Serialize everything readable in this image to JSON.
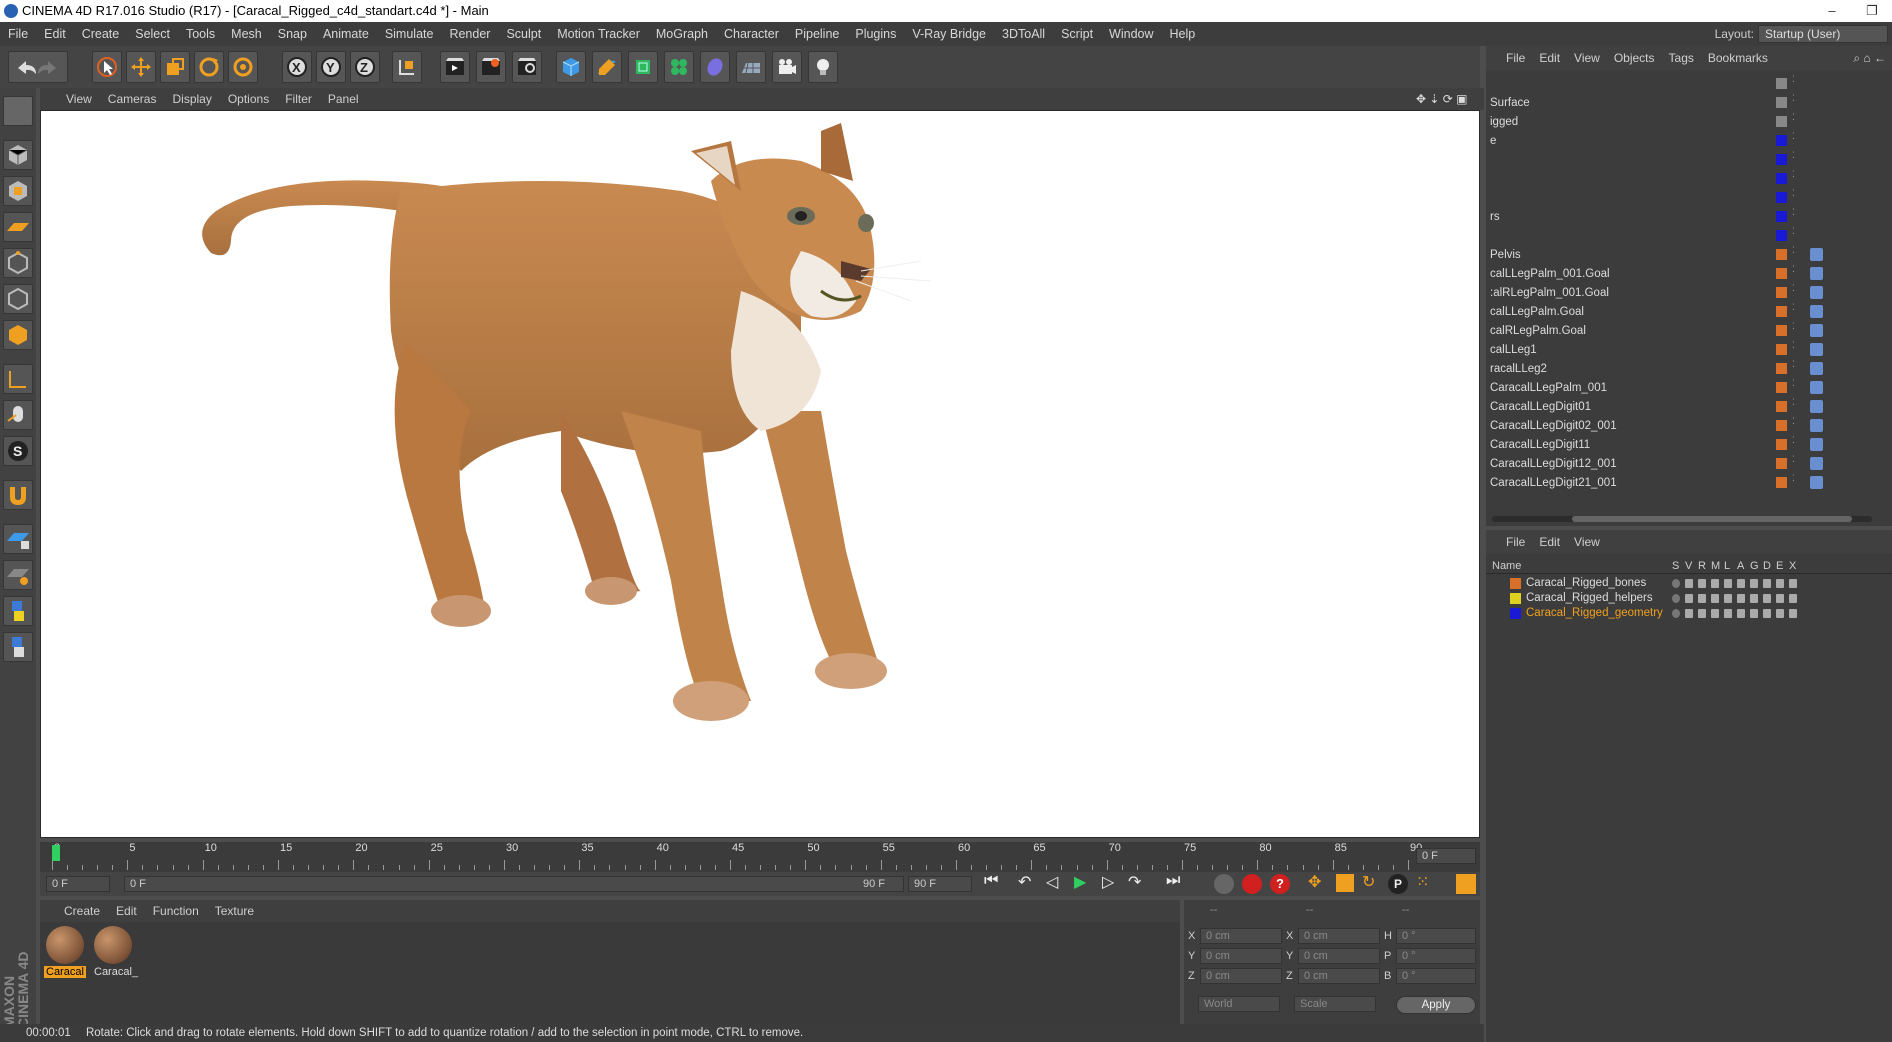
{
  "titlebar": {
    "title": "CINEMA 4D R17.016 Studio (R17) - [Caracal_Rigged_c4d_standart.c4d *] - Main",
    "min": "–",
    "max": "❐",
    "close": "✕"
  },
  "menubar": {
    "items": [
      "File",
      "Edit",
      "Create",
      "Select",
      "Tools",
      "Mesh",
      "Snap",
      "Animate",
      "Simulate",
      "Render",
      "Sculpt",
      "Motion Tracker",
      "MoGraph",
      "Character",
      "Pipeline",
      "Plugins",
      "V-Ray Bridge",
      "3DToAll",
      "Script",
      "Window",
      "Help"
    ],
    "layout_label": "Layout:",
    "layout_value": "Startup (User)"
  },
  "viewport": {
    "menu": [
      "View",
      "Cameras",
      "Display",
      "Options",
      "Filter",
      "Panel"
    ]
  },
  "timeline": {
    "ticks": [
      "0",
      "5",
      "10",
      "15",
      "20",
      "25",
      "30",
      "35",
      "40",
      "45",
      "50",
      "55",
      "60",
      "65",
      "70",
      "75",
      "80",
      "85",
      "90"
    ],
    "current_frame": "0 F",
    "start_field": "0 F",
    "range_start": "0 F",
    "range_end": "90 F",
    "end_field": "90 F"
  },
  "materials": {
    "menu": [
      "Create",
      "Edit",
      "Function",
      "Texture"
    ],
    "items": [
      {
        "label": "Caracal"
      },
      {
        "label": "Caracal_"
      }
    ]
  },
  "coords": {
    "rows": [
      {
        "a": "X",
        "av": "0 cm",
        "b": "X",
        "bv": "0 cm",
        "c": "H",
        "cv": "0 °"
      },
      {
        "a": "Y",
        "av": "0 cm",
        "b": "Y",
        "bv": "0 cm",
        "c": "P",
        "cv": "0 °"
      },
      {
        "a": "Z",
        "av": "0 cm",
        "b": "Z",
        "bv": "0 cm",
        "c": "B",
        "cv": "0 °"
      }
    ],
    "head1": "--",
    "head2": "--",
    "head3": "--",
    "world": "World",
    "scale": "Scale",
    "apply": "Apply"
  },
  "status": {
    "time": "00:00:01",
    "message": "Rotate: Click and drag to rotate elements. Hold down SHIFT to add to quantize rotation / add to the selection in point mode, CTRL to remove."
  },
  "objects": {
    "menu": [
      "File",
      "Edit",
      "View",
      "Objects",
      "Tags",
      "Bookmarks"
    ],
    "rows": [
      {
        "name": "",
        "color": "#888"
      },
      {
        "name": "Surface",
        "color": "#888"
      },
      {
        "name": "igged",
        "color": "#888"
      },
      {
        "name": "e",
        "color": "#1a1ad6"
      },
      {
        "name": "",
        "color": "#1a1ad6"
      },
      {
        "name": "",
        "color": "#1a1ad6"
      },
      {
        "name": "",
        "color": "#1a1ad6"
      },
      {
        "name": "rs",
        "color": "#1a1ad6"
      },
      {
        "name": "",
        "color": "#1a1ad6"
      },
      {
        "name": "Pelvis",
        "color": "#d8702a"
      },
      {
        "name": "calLLegPalm_001.Goal",
        "color": "#d8702a"
      },
      {
        "name": ":alRLegPalm_001.Goal",
        "color": "#d8702a"
      },
      {
        "name": "calLLegPalm.Goal",
        "color": "#d8702a"
      },
      {
        "name": "calRLegPalm.Goal",
        "color": "#d8702a"
      },
      {
        "name": "calLLeg1",
        "color": "#d8702a"
      },
      {
        "name": "racalLLeg2",
        "color": "#d8702a"
      },
      {
        "name": "CaracalLLegPalm_001",
        "color": "#d8702a"
      },
      {
        "name": "CaracalLLegDigit01",
        "color": "#d8702a"
      },
      {
        "name": "CaracalLLegDigit02_001",
        "color": "#d8702a"
      },
      {
        "name": "CaracalLLegDigit11",
        "color": "#d8702a"
      },
      {
        "name": "CaracalLLegDigit12_001",
        "color": "#d8702a"
      },
      {
        "name": "CaracalLLegDigit21_001",
        "color": "#d8702a"
      }
    ]
  },
  "layers": {
    "menu": [
      "File",
      "Edit",
      "View"
    ],
    "header": {
      "name": "Name",
      "cols": [
        "S",
        "V",
        "R",
        "M",
        "L",
        "A",
        "G",
        "D",
        "E",
        "X"
      ]
    },
    "rows": [
      {
        "name": "Caracal_Rigged_bones",
        "color": "#d8702a",
        "selected": false
      },
      {
        "name": "Caracal_Rigged_helpers",
        "color": "#e0d020",
        "selected": false
      },
      {
        "name": "Caracal_Rigged_geometry",
        "color": "#1a1ad6",
        "selected": true
      }
    ]
  },
  "brand": "MAXON CINEMA 4D"
}
